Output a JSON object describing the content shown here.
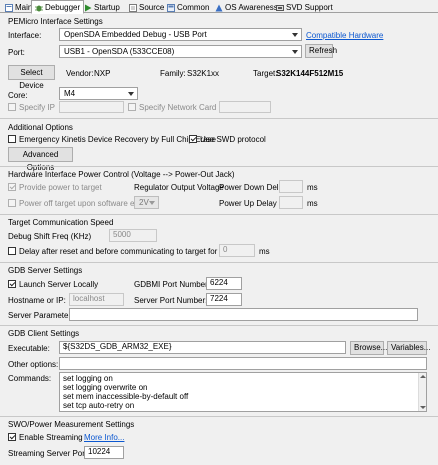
{
  "tabs": [
    {
      "label": "Main",
      "icon": "main-tab-icon"
    },
    {
      "label": "Debugger",
      "icon": "debugger-tab-icon"
    },
    {
      "label": "Startup",
      "icon": "startup-tab-icon"
    },
    {
      "label": "Source",
      "icon": "source-tab-icon"
    },
    {
      "label": "Common",
      "icon": "common-tab-icon"
    },
    {
      "label": "OS Awareness",
      "icon": "os-awareness-tab-icon"
    },
    {
      "label": "SVD Support",
      "icon": "svd-support-tab-icon"
    }
  ],
  "interface_settings": {
    "title": "PEMicro Interface Settings",
    "interface_label": "Interface:",
    "interface_value": "OpenSDA Embedded Debug - USB Port",
    "compatible_hw_link": "Compatible Hardware",
    "port_label": "Port:",
    "port_value": "USB1 - OpenSDA (533CCE08)",
    "refresh_label": "Refresh",
    "select_device_label": "Select Device",
    "vendor_label": "Vendor:",
    "vendor_value": "NXP",
    "family_label": "Family:",
    "family_value": "S32K1xx",
    "target_label": "Target:",
    "target_value": "S32K144F512M15",
    "core_label": "Core:",
    "core_value": "M4",
    "specify_ip_label": "Specify IP",
    "specify_network_card_label": "Specify Network Card IP"
  },
  "additional_options": {
    "title": "Additional Options",
    "emergency_label": "Emergency Kinetis Device Recovery by Full Chip Erase",
    "swd_label": "Use SWD protocol",
    "advanced_label": "Advanced Options"
  },
  "power_control": {
    "title": "Hardware Interface Power Control (Voltage --> Power-Out Jack)",
    "provide_power_label": "Provide power to target",
    "regulator_label": "Regulator Output Voltage",
    "power_down_label": "Power Down Delay",
    "power_down_unit": "ms",
    "power_off_label": "Power off target upon software exit",
    "voltage_value": "2V",
    "power_up_label": "Power Up Delay",
    "power_up_unit": "ms"
  },
  "target_comm": {
    "title": "Target Communication Speed",
    "shift_freq_label": "Debug Shift Freq (KHz)",
    "shift_freq_value": "5000",
    "delay_label": "Delay after reset and before communicating to target for",
    "delay_value": "0",
    "delay_unit": "ms"
  },
  "gdb_server": {
    "title": "GDB Server Settings",
    "launch_label": "Launch Server Locally",
    "gdbmi_port_label": "GDBMI Port Number:",
    "gdbmi_port_value": "6224",
    "hostname_label": "Hostname or IP:",
    "hostname_placeholder": "localhost",
    "server_port_label": "Server Port Number:",
    "server_port_value": "7224",
    "server_params_label": "Server Parameters:"
  },
  "gdb_client": {
    "title": "GDB Client Settings",
    "executable_label": "Executable:",
    "executable_value": "${S32DS_GDB_ARM32_EXE}",
    "browse_label": "Browse...",
    "variables_label": "Variables...",
    "other_options_label": "Other options:",
    "commands_label": "Commands:",
    "commands": [
      "set logging on",
      "set logging overwrite on",
      "set mem inaccessible-by-default off",
      "set tcp auto-retry on"
    ]
  },
  "swo": {
    "title": "SWO/Power Measurement Settings",
    "enable_label": "Enable Streaming",
    "more_info_link": "More Info...",
    "streaming_port_label": "Streaming Server Port:",
    "streaming_port_value": "10224"
  },
  "colors": {
    "link": "#0b57d0",
    "tab_active_bg": "#ffffff",
    "panel_bg": "#f0f0f0"
  }
}
